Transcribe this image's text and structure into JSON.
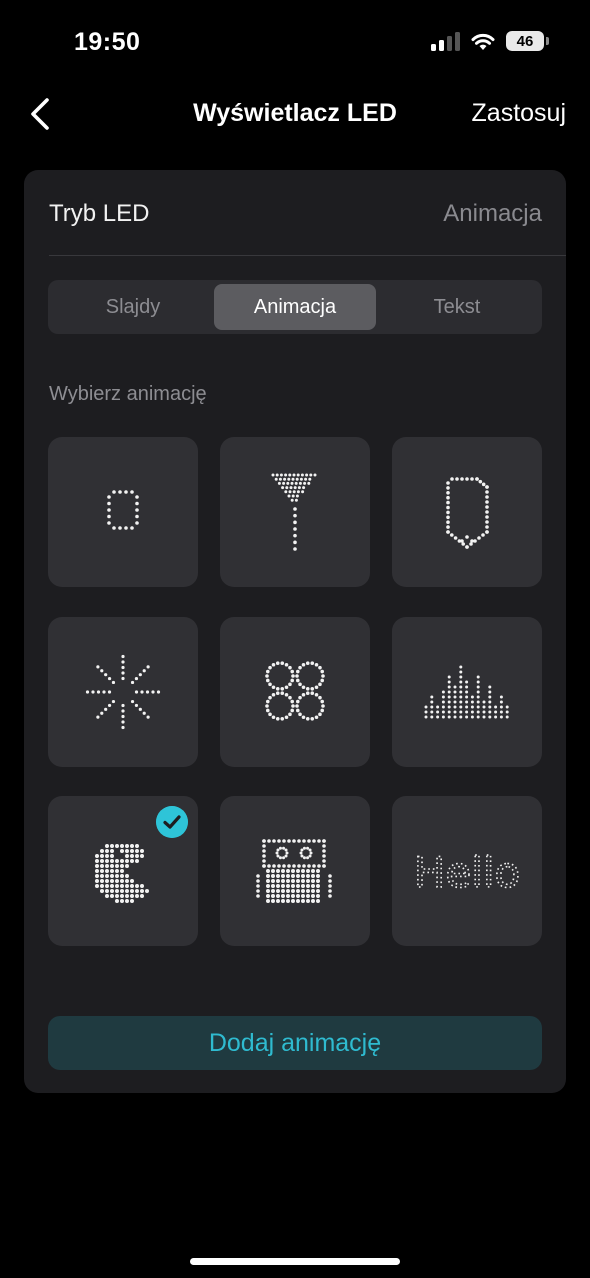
{
  "status_bar": {
    "time": "19:50",
    "battery": "46"
  },
  "nav": {
    "title": "Wyświetlacz LED",
    "apply_label": "Zastosuj"
  },
  "mode": {
    "label": "Tryb LED",
    "value": "Animacja"
  },
  "tabs": [
    {
      "label": "Slajdy",
      "active": false
    },
    {
      "label": "Animacja",
      "active": true
    },
    {
      "label": "Tekst",
      "active": false
    }
  ],
  "section_label": "Wybierz animację",
  "animations": [
    {
      "icon": "dot-digit-zero-icon",
      "selected": false
    },
    {
      "icon": "dot-funnel-icon",
      "selected": false
    },
    {
      "icon": "dot-tag-icon",
      "selected": false
    },
    {
      "icon": "dot-sparkle-icon",
      "selected": false
    },
    {
      "icon": "dot-clover-icon",
      "selected": false
    },
    {
      "icon": "dot-equalizer-icon",
      "selected": false
    },
    {
      "icon": "dot-pacman-icon",
      "selected": true
    },
    {
      "icon": "dot-robot-icon",
      "selected": false
    },
    {
      "icon": "dot-hello-text-icon",
      "selected": false,
      "text": "Hello"
    }
  ],
  "add_button_label": "Dodaj animację",
  "colors": {
    "accent": "#2fbbd0",
    "card": "#1d1d20",
    "tile": "#303034"
  }
}
